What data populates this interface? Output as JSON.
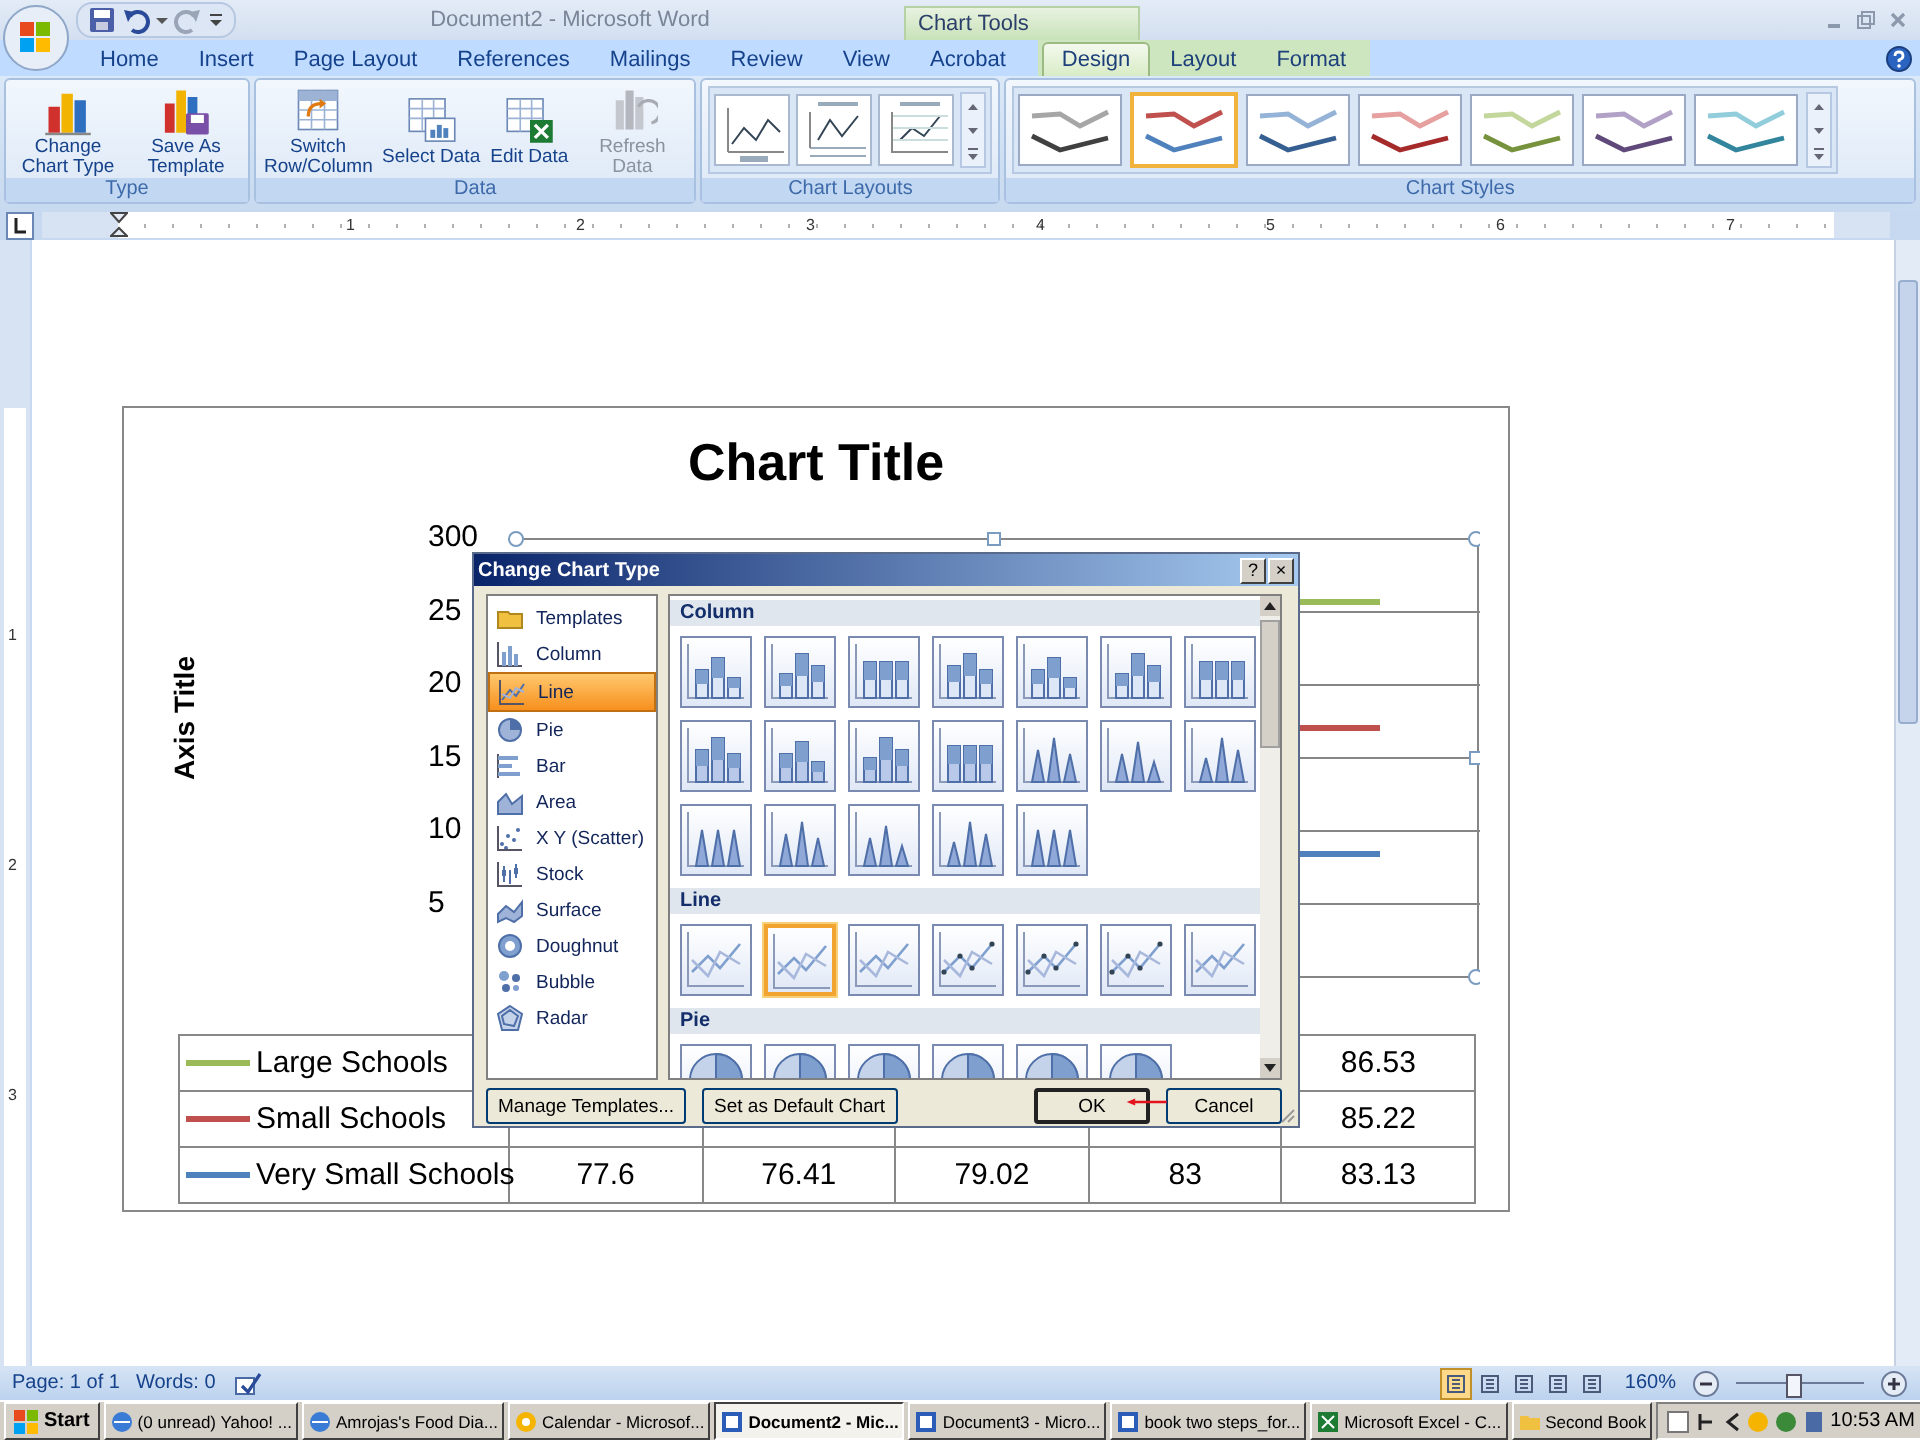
{
  "window": {
    "title": "Document2 - Microsoft Word",
    "contextual_title": "Chart Tools"
  },
  "tabs": [
    {
      "label": "Home",
      "selected": false,
      "contextual": false
    },
    {
      "label": "Insert",
      "selected": false,
      "contextual": false
    },
    {
      "label": "Page Layout",
      "selected": false,
      "contextual": false
    },
    {
      "label": "References",
      "selected": false,
      "contextual": false
    },
    {
      "label": "Mailings",
      "selected": false,
      "contextual": false
    },
    {
      "label": "Review",
      "selected": false,
      "contextual": false
    },
    {
      "label": "View",
      "selected": false,
      "contextual": false
    },
    {
      "label": "Acrobat",
      "selected": false,
      "contextual": false
    },
    {
      "label": "Design",
      "selected": true,
      "contextual": true
    },
    {
      "label": "Layout",
      "selected": false,
      "contextual": true
    },
    {
      "label": "Format",
      "selected": false,
      "contextual": true
    }
  ],
  "ribbon": {
    "type_group": {
      "label": "Type",
      "buttons": [
        {
          "label": "Change Chart Type",
          "disabled": false
        },
        {
          "label": "Save As Template",
          "disabled": false
        }
      ]
    },
    "data_group": {
      "label": "Data",
      "buttons": [
        {
          "label": "Switch Row/Column",
          "disabled": false
        },
        {
          "label": "Select Data",
          "disabled": false
        },
        {
          "label": "Edit Data",
          "disabled": false
        },
        {
          "label": "Refresh Data",
          "disabled": true
        }
      ]
    },
    "layouts_group": {
      "label": "Chart Layouts",
      "layouts": [
        {
          "selected": false
        },
        {
          "selected": false
        },
        {
          "selected": false
        }
      ]
    },
    "styles_group": {
      "label": "Chart Styles",
      "styles": [
        {
          "selected": false,
          "lines": [
            {
              "color": "#a6a6a6"
            },
            {
              "color": "#404040"
            }
          ]
        },
        {
          "selected": true,
          "lines": [
            {
              "color": "#c0504d"
            },
            {
              "color": "#4f81bd"
            }
          ]
        },
        {
          "selected": false,
          "lines": [
            {
              "color": "#95b3d7"
            },
            {
              "color": "#365f91"
            }
          ]
        },
        {
          "selected": false,
          "lines": [
            {
              "color": "#e6a0a0"
            },
            {
              "color": "#a52a2a"
            }
          ]
        },
        {
          "selected": false,
          "lines": [
            {
              "color": "#c3d69b"
            },
            {
              "color": "#76923c"
            }
          ]
        },
        {
          "selected": false,
          "lines": [
            {
              "color": "#b2a1c7"
            },
            {
              "color": "#5f497a"
            }
          ]
        },
        {
          "selected": false,
          "lines": [
            {
              "color": "#92cddc"
            },
            {
              "color": "#31859c"
            }
          ]
        }
      ]
    }
  },
  "ruler": {
    "horizontal_numbers": [
      "1",
      "2",
      "3",
      "4",
      "5",
      "6",
      "7"
    ],
    "vertical_numbers": [
      "1",
      "2",
      "3"
    ]
  },
  "chart": {
    "title": "Chart Title",
    "axis_title": "Axis Title",
    "y_labels": [
      "300",
      "25",
      "20",
      "15",
      "10",
      "5"
    ],
    "table": {
      "rows": [
        {
          "name": "Large Schools",
          "color": "#9bbb59",
          "cells": [
            "86.53"
          ]
        },
        {
          "name": "Small Schools",
          "color": "#c0504d",
          "cells": [
            "85.22"
          ]
        },
        {
          "name": "Very Small Schools",
          "color": "#4f81bd",
          "cells": [
            "77.6",
            "76.41",
            "79.02",
            "83",
            "83.13"
          ]
        }
      ]
    }
  },
  "dialog": {
    "title": "Change Chart Type",
    "title_buttons": [
      "?",
      "×"
    ],
    "categories": [
      {
        "label": "Templates",
        "selected": false
      },
      {
        "label": "Column",
        "selected": false
      },
      {
        "label": "Line",
        "selected": true
      },
      {
        "label": "Pie",
        "selected": false
      },
      {
        "label": "Bar",
        "selected": false
      },
      {
        "label": "Area",
        "selected": false
      },
      {
        "label": "X Y (Scatter)",
        "selected": false
      },
      {
        "label": "Stock",
        "selected": false
      },
      {
        "label": "Surface",
        "selected": false
      },
      {
        "label": "Doughnut",
        "selected": false
      },
      {
        "label": "Bubble",
        "selected": false
      },
      {
        "label": "Radar",
        "selected": false
      }
    ],
    "sections": [
      {
        "title": "Column",
        "kind": "column",
        "thumbnails": [
          {
            "selected": false
          },
          {
            "selected": false
          },
          {
            "selected": false
          },
          {
            "selected": false
          },
          {
            "selected": false
          },
          {
            "selected": false
          },
          {
            "selected": false
          },
          {
            "selected": false
          },
          {
            "selected": false
          },
          {
            "selected": false
          },
          {
            "selected": false
          },
          {
            "selected": false
          },
          {
            "selected": false
          },
          {
            "selected": false
          },
          {
            "selected": false
          },
          {
            "selected": false
          },
          {
            "selected": false
          },
          {
            "selected": false
          },
          {
            "selected": false
          }
        ]
      },
      {
        "title": "Line",
        "kind": "line",
        "thumbnails": [
          {
            "selected": false
          },
          {
            "selected": true
          },
          {
            "selected": false
          },
          {
            "selected": false
          },
          {
            "selected": false
          },
          {
            "selected": false
          },
          {
            "selected": false
          }
        ]
      },
      {
        "title": "Pie",
        "kind": "pie",
        "thumbnails": [
          {
            "selected": false
          },
          {
            "selected": false
          },
          {
            "selected": false
          },
          {
            "selected": false
          },
          {
            "selected": false
          },
          {
            "selected": false
          }
        ]
      }
    ],
    "buttons": [
      {
        "label": "Manage Templates...",
        "default": false
      },
      {
        "label": "Set as Default Chart",
        "default": false
      },
      {
        "label": "OK",
        "default": true
      },
      {
        "label": "Cancel",
        "default": false
      }
    ]
  },
  "status_bar": {
    "page": "Page: 1 of 1",
    "words": "Words: 0",
    "views": [
      {
        "selected": true
      },
      {
        "selected": false
      },
      {
        "selected": false
      },
      {
        "selected": false
      },
      {
        "selected": false
      }
    ],
    "zoom": "160%",
    "zoom_slider": {
      "level": 0.45
    }
  },
  "taskbar": {
    "start": "Start",
    "items": [
      {
        "label": "(0 unread) Yahoo! ...",
        "selected": false
      },
      {
        "label": "Amrojas's Food Dia...",
        "selected": false
      },
      {
        "label": "Calendar - Microsof...",
        "selected": false
      },
      {
        "label": "Document2 - Mic...",
        "selected": true
      },
      {
        "label": "Document3 - Micro...",
        "selected": false
      },
      {
        "label": "book two steps_for...",
        "selected": false
      },
      {
        "label": "Microsoft Excel - C...",
        "selected": false
      },
      {
        "label": "Second Book",
        "selected": false
      }
    ],
    "clock": "10:53 AM"
  }
}
